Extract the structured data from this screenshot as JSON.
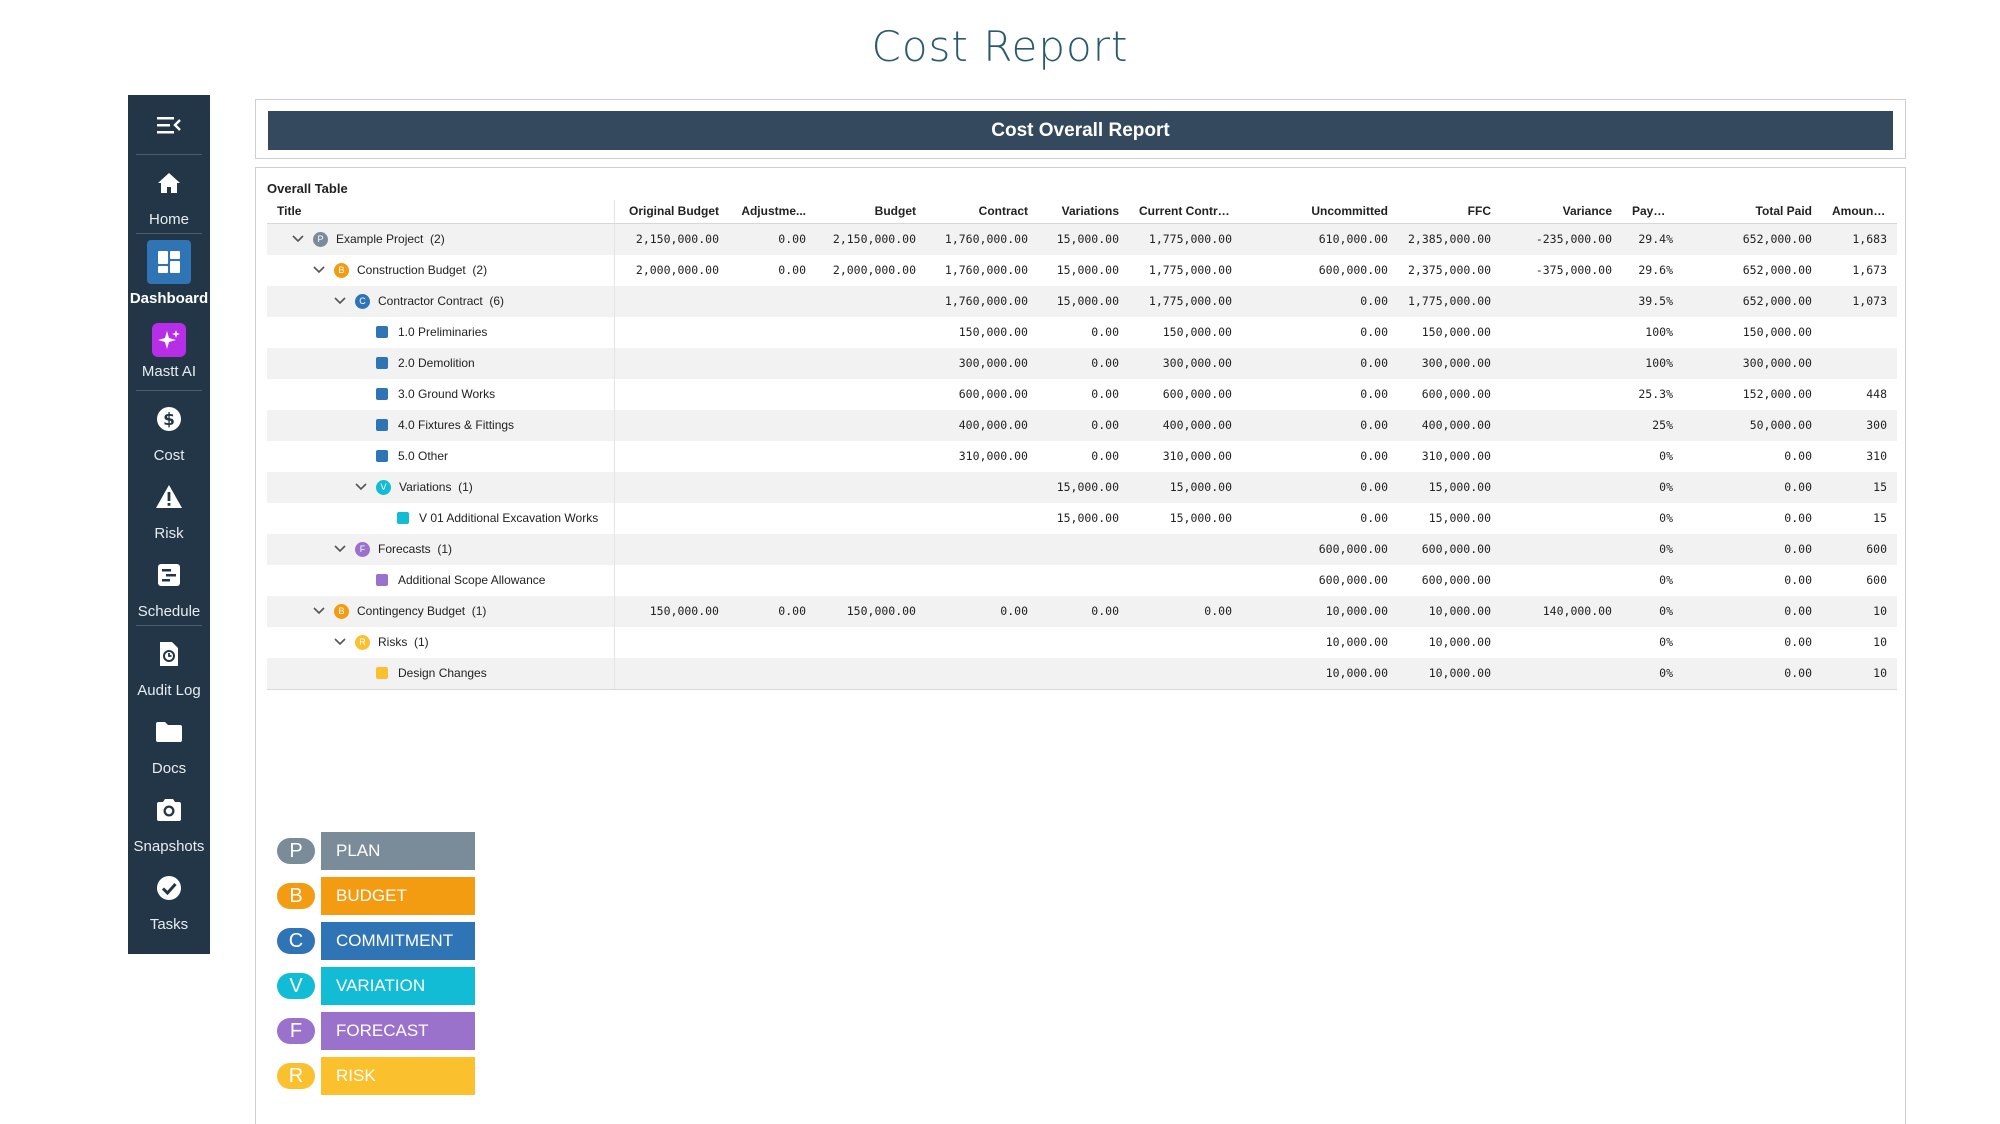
{
  "page_title": "Cost Report",
  "header_title": "Cost Overall Report",
  "table_caption": "Overall Table",
  "colors": {
    "plan": "#7a8c99",
    "budget": "#f39c12",
    "commitment": "#2f74b5",
    "variation": "#12bcd4",
    "forecast": "#9b72cb",
    "risk": "#fbc02d",
    "sidebar": "#233648",
    "header_bar": "#34495e"
  },
  "sidebar": {
    "menu_icon": "menu-collapse-icon",
    "items": [
      {
        "label": "Home",
        "icon": "home-icon"
      },
      {
        "label": "Dashboard",
        "icon": "dashboard-icon"
      },
      {
        "label": "Mastt AI",
        "icon": "sparkle-icon"
      },
      {
        "label": "Cost",
        "icon": "dollar-icon"
      },
      {
        "label": "Risk",
        "icon": "warning-icon"
      },
      {
        "label": "Schedule",
        "icon": "schedule-icon"
      },
      {
        "label": "Audit Log",
        "icon": "audit-log-icon"
      },
      {
        "label": "Docs",
        "icon": "folder-icon"
      },
      {
        "label": "Snapshots",
        "icon": "camera-icon"
      },
      {
        "label": "Tasks",
        "icon": "check-circle-icon"
      }
    ]
  },
  "columns": [
    "Title",
    "Original Budget",
    "Adjustme...",
    "Budget",
    "Contract",
    "Variations",
    "Current Contract",
    "Uncommitted",
    "FFC",
    "Variance",
    "Paym...",
    "Total Paid",
    "Amount Re"
  ],
  "rows": [
    {
      "title": "Example Project  (2)",
      "level": 0,
      "expand": true,
      "marker": "circle",
      "type": "plan",
      "letter": "P",
      "values": [
        "2,150,000.00",
        "0.00",
        "2,150,000.00",
        "1,760,000.00",
        "15,000.00",
        "1,775,000.00",
        "610,000.00",
        "2,385,000.00",
        "-235,000.00",
        "29.4%",
        "652,000.00",
        "1,683"
      ],
      "variance_tone": "neg"
    },
    {
      "title": "Construction Budget  (2)",
      "level": 1,
      "expand": true,
      "marker": "circle",
      "type": "budget",
      "letter": "B",
      "values": [
        "2,000,000.00",
        "0.00",
        "2,000,000.00",
        "1,760,000.00",
        "15,000.00",
        "1,775,000.00",
        "600,000.00",
        "2,375,000.00",
        "-375,000.00",
        "29.6%",
        "652,000.00",
        "1,673"
      ],
      "variance_tone": "neg"
    },
    {
      "title": "Contractor Contract  (6)",
      "level": 2,
      "expand": true,
      "marker": "circle",
      "type": "commitment",
      "letter": "C",
      "values": [
        "",
        "",
        "",
        "1,760,000.00",
        "15,000.00",
        "1,775,000.00",
        "0.00",
        "1,775,000.00",
        "",
        "39.5%",
        "652,000.00",
        "1,073"
      ],
      "variance_tone": ""
    },
    {
      "title": "1.0 Preliminaries",
      "level": 3,
      "expand": false,
      "marker": "square",
      "type": "commitment",
      "letter": "",
      "values": [
        "",
        "",
        "",
        "150,000.00",
        "0.00",
        "150,000.00",
        "0.00",
        "150,000.00",
        "",
        "100%",
        "150,000.00",
        ""
      ],
      "variance_tone": ""
    },
    {
      "title": "2.0 Demolition",
      "level": 3,
      "expand": false,
      "marker": "square",
      "type": "commitment",
      "letter": "",
      "values": [
        "",
        "",
        "",
        "300,000.00",
        "0.00",
        "300,000.00",
        "0.00",
        "300,000.00",
        "",
        "100%",
        "300,000.00",
        ""
      ],
      "variance_tone": ""
    },
    {
      "title": "3.0 Ground Works",
      "level": 3,
      "expand": false,
      "marker": "square",
      "type": "commitment",
      "letter": "",
      "values": [
        "",
        "",
        "",
        "600,000.00",
        "0.00",
        "600,000.00",
        "0.00",
        "600,000.00",
        "",
        "25.3%",
        "152,000.00",
        "448"
      ],
      "variance_tone": ""
    },
    {
      "title": "4.0 Fixtures & Fittings",
      "level": 3,
      "expand": false,
      "marker": "square",
      "type": "commitment",
      "letter": "",
      "values": [
        "",
        "",
        "",
        "400,000.00",
        "0.00",
        "400,000.00",
        "0.00",
        "400,000.00",
        "",
        "25%",
        "50,000.00",
        "300"
      ],
      "variance_tone": ""
    },
    {
      "title": "5.0 Other",
      "level": 3,
      "expand": false,
      "marker": "square",
      "type": "commitment",
      "letter": "",
      "values": [
        "",
        "",
        "",
        "310,000.00",
        "0.00",
        "310,000.00",
        "0.00",
        "310,000.00",
        "",
        "0%",
        "0.00",
        "310"
      ],
      "variance_tone": ""
    },
    {
      "title": "Variations  (1)",
      "level": 3,
      "expand": true,
      "marker": "circle",
      "type": "variation",
      "letter": "V",
      "values": [
        "",
        "",
        "",
        "",
        "15,000.00",
        "15,000.00",
        "0.00",
        "15,000.00",
        "",
        "0%",
        "0.00",
        "15"
      ],
      "variance_tone": ""
    },
    {
      "title": "V 01 Additional Excavation Works",
      "level": 4,
      "expand": false,
      "marker": "square",
      "type": "variation",
      "letter": "",
      "values": [
        "",
        "",
        "",
        "",
        "15,000.00",
        "15,000.00",
        "0.00",
        "15,000.00",
        "",
        "0%",
        "0.00",
        "15"
      ],
      "variance_tone": ""
    },
    {
      "title": "Forecasts  (1)",
      "level": 2,
      "expand": true,
      "marker": "circle",
      "type": "forecast",
      "letter": "F",
      "values": [
        "",
        "",
        "",
        "",
        "",
        "",
        "600,000.00",
        "600,000.00",
        "",
        "0%",
        "0.00",
        "600"
      ],
      "variance_tone": ""
    },
    {
      "title": "Additional Scope Allowance",
      "level": 3,
      "expand": false,
      "marker": "square",
      "type": "forecast",
      "letter": "",
      "values": [
        "",
        "",
        "",
        "",
        "",
        "",
        "600,000.00",
        "600,000.00",
        "",
        "0%",
        "0.00",
        "600"
      ],
      "variance_tone": ""
    },
    {
      "title": "Contingency Budget  (1)",
      "level": 1,
      "expand": true,
      "marker": "circle",
      "type": "budget",
      "letter": "B",
      "values": [
        "150,000.00",
        "0.00",
        "150,000.00",
        "0.00",
        "0.00",
        "0.00",
        "10,000.00",
        "10,000.00",
        "140,000.00",
        "0%",
        "0.00",
        "10"
      ],
      "variance_tone": "pos"
    },
    {
      "title": "Risks  (1)",
      "level": 2,
      "expand": true,
      "marker": "circle",
      "type": "risk",
      "letter": "R",
      "values": [
        "",
        "",
        "",
        "",
        "",
        "",
        "10,000.00",
        "10,000.00",
        "",
        "0%",
        "0.00",
        "10"
      ],
      "variance_tone": ""
    },
    {
      "title": "Design Changes",
      "level": 3,
      "expand": false,
      "marker": "square",
      "type": "risk",
      "letter": "",
      "values": [
        "",
        "",
        "",
        "",
        "",
        "",
        "10,000.00",
        "10,000.00",
        "",
        "0%",
        "0.00",
        "10"
      ],
      "variance_tone": ""
    }
  ],
  "legend": [
    {
      "letter": "P",
      "label": "PLAN",
      "type": "plan"
    },
    {
      "letter": "B",
      "label": "BUDGET",
      "type": "budget"
    },
    {
      "letter": "C",
      "label": "COMMITMENT",
      "type": "commitment"
    },
    {
      "letter": "V",
      "label": "VARIATION",
      "type": "variation"
    },
    {
      "letter": "F",
      "label": "FORECAST",
      "type": "forecast"
    },
    {
      "letter": "R",
      "label": "RISK",
      "type": "risk"
    }
  ]
}
